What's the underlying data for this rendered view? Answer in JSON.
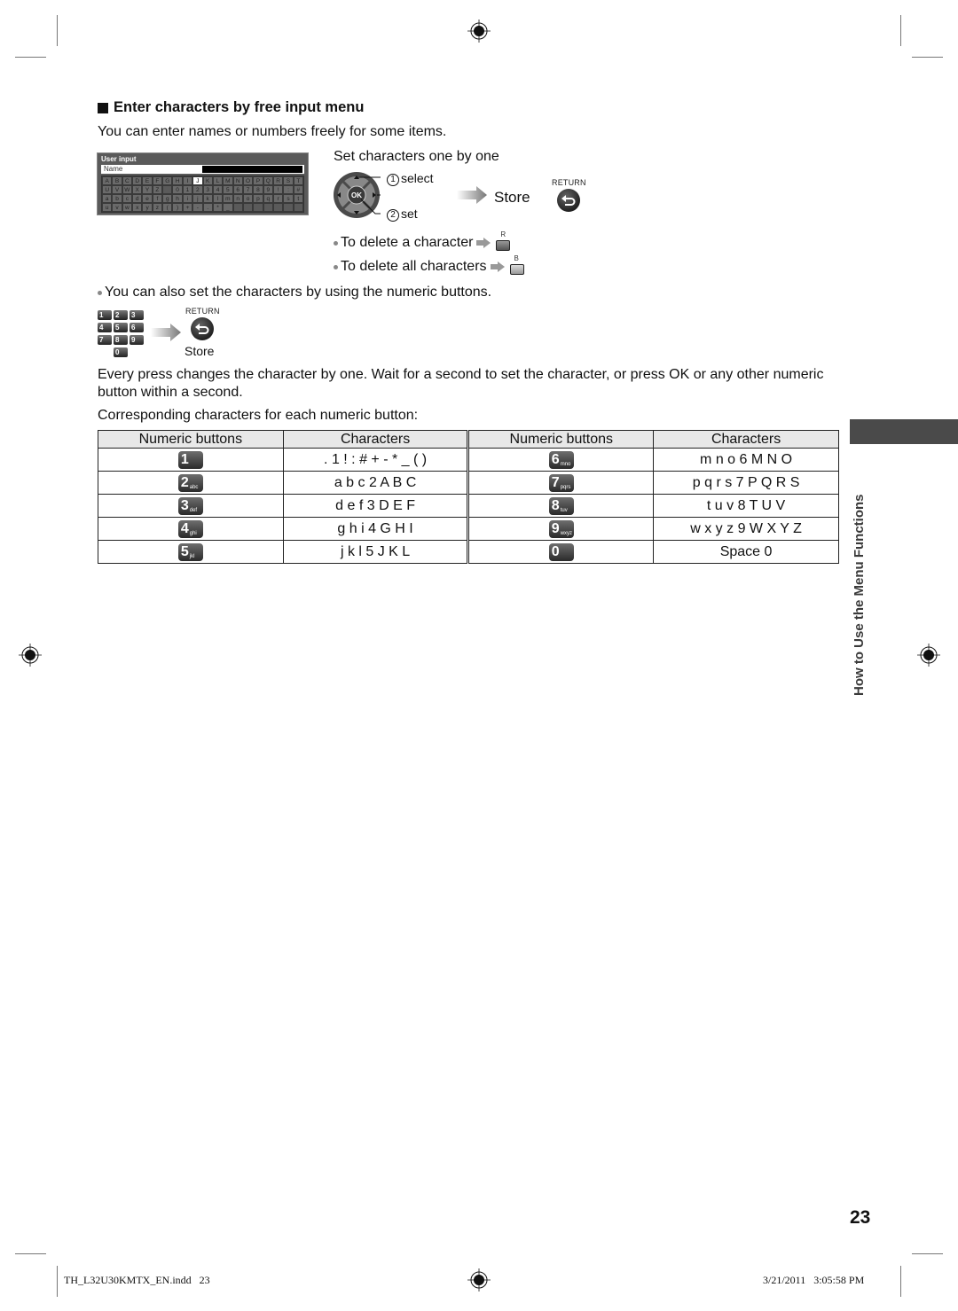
{
  "section": {
    "heading": "Enter characters by free input menu",
    "intro": "You can enter names or numbers freely for some items."
  },
  "user_input_screen": {
    "title": "User input",
    "name_label": "Name",
    "selected_key": "J",
    "rows": [
      [
        "A",
        "B",
        "C",
        "D",
        "E",
        "F",
        "G",
        "H",
        "I",
        "J",
        "K",
        "L",
        "M",
        "N",
        "O",
        "P",
        "Q",
        "R",
        "S",
        "T"
      ],
      [
        "U",
        "V",
        "W",
        "X",
        "Y",
        "Z",
        "",
        "0",
        "1",
        "2",
        "3",
        "4",
        "5",
        "6",
        "7",
        "8",
        "9",
        "!",
        ":",
        "#"
      ],
      [
        "a",
        "b",
        "c",
        "d",
        "e",
        "f",
        "g",
        "h",
        "i",
        "j",
        "k",
        "l",
        "m",
        "n",
        "o",
        "p",
        "q",
        "r",
        "s",
        "t"
      ],
      [
        "u",
        "v",
        "w",
        "x",
        "y",
        "z",
        "(",
        ")",
        "+",
        "-",
        ".",
        "*",
        "_",
        "",
        "",
        "",
        "",
        "",
        "",
        ""
      ]
    ]
  },
  "set_one_by_one": {
    "title": "Set characters one by one",
    "ok_label": "OK",
    "step1_num": "1",
    "step1": "select",
    "step2_num": "2",
    "step2": "set",
    "store": "Store",
    "return_label": "RETURN"
  },
  "delete": {
    "one": "To delete a character",
    "one_button": "R",
    "all": "To delete all characters",
    "all_button": "B"
  },
  "numeric_note": "You can also set the characters by using the numeric buttons.",
  "mini_keypad": {
    "keys": [
      "1",
      "2",
      "3",
      "4",
      "5",
      "6",
      "7",
      "8",
      "9",
      "0"
    ],
    "return_label": "RETURN",
    "store": "Store"
  },
  "paragraph1": "Every press changes the character by one. Wait for a second to set the character, or press OK or any other numeric button within a second.",
  "paragraph2": "Corresponding characters for each numeric button:",
  "table": {
    "headers": [
      "Numeric buttons",
      "Characters",
      "Numeric buttons",
      "Characters"
    ],
    "rows": [
      {
        "b1": "1",
        "s1": "",
        "c1": ". 1 ! : # + - * _ ( )",
        "b2": "6",
        "s2": "mno",
        "c2": "m n o 6 M N O"
      },
      {
        "b1": "2",
        "s1": "abc",
        "c1": "a b c 2 A B C",
        "b2": "7",
        "s2": "pqrs",
        "c2": "p q r s 7 P Q R S"
      },
      {
        "b1": "3",
        "s1": "def",
        "c1": "d e f 3 D E F",
        "b2": "8",
        "s2": "tuv",
        "c2": "t u v 8 T U V"
      },
      {
        "b1": "4",
        "s1": "ghi",
        "c1": "g h i 4 G H I",
        "b2": "9",
        "s2": "wxyz",
        "c2": "w x y z 9 W X Y Z"
      },
      {
        "b1": "5",
        "s1": "jkl",
        "c1": "j k l 5 J K L",
        "b2": "0",
        "s2": "",
        "c2": "Space 0"
      }
    ]
  },
  "side_tab_text": "How to Use the Menu Functions",
  "page_number": "23",
  "footer": {
    "file": "TH_L32U30KMTX_EN.indd   23",
    "timestamp": "3/21/2011   3:05:58 PM"
  }
}
